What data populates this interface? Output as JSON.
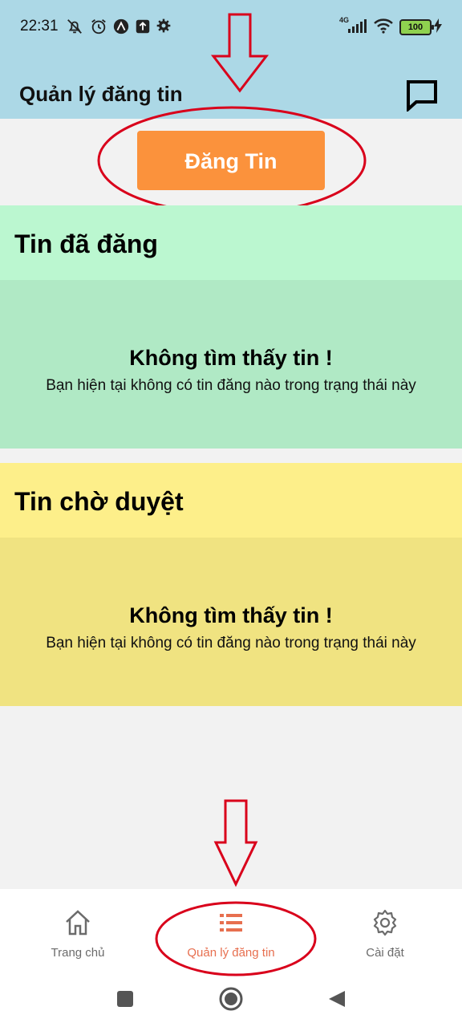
{
  "status_bar": {
    "time": "22:31",
    "network": "4G",
    "battery": "100"
  },
  "header": {
    "title": "Quản lý đăng tin"
  },
  "post_button_label": "Đăng Tin",
  "sections": [
    {
      "title": "Tin đã đăng",
      "empty_title": "Không tìm thấy tin !",
      "empty_desc": "Bạn hiện tại không có tin đăng nào trong trạng thái này"
    },
    {
      "title": "Tin chờ duyệt",
      "empty_title": "Không tìm thấy tin !",
      "empty_desc": "Bạn hiện tại không có tin đăng nào trong trạng thái này"
    }
  ],
  "bottom_nav": [
    {
      "label": "Trang chủ",
      "icon": "home-icon",
      "active": false
    },
    {
      "label": "Quản lý đăng tin",
      "icon": "list-icon",
      "active": true
    },
    {
      "label": "Cài đặt",
      "icon": "gear-icon",
      "active": false
    }
  ],
  "colors": {
    "header_bg": "#acd8e6",
    "post_button": "#fb923c",
    "posted_header": "#bbf7d0",
    "posted_body": "#b0e9c5",
    "pending_header": "#fdef8a",
    "pending_body": "#f0e381",
    "annotation_red": "#d9001b",
    "active_nav": "#e76f4f"
  }
}
